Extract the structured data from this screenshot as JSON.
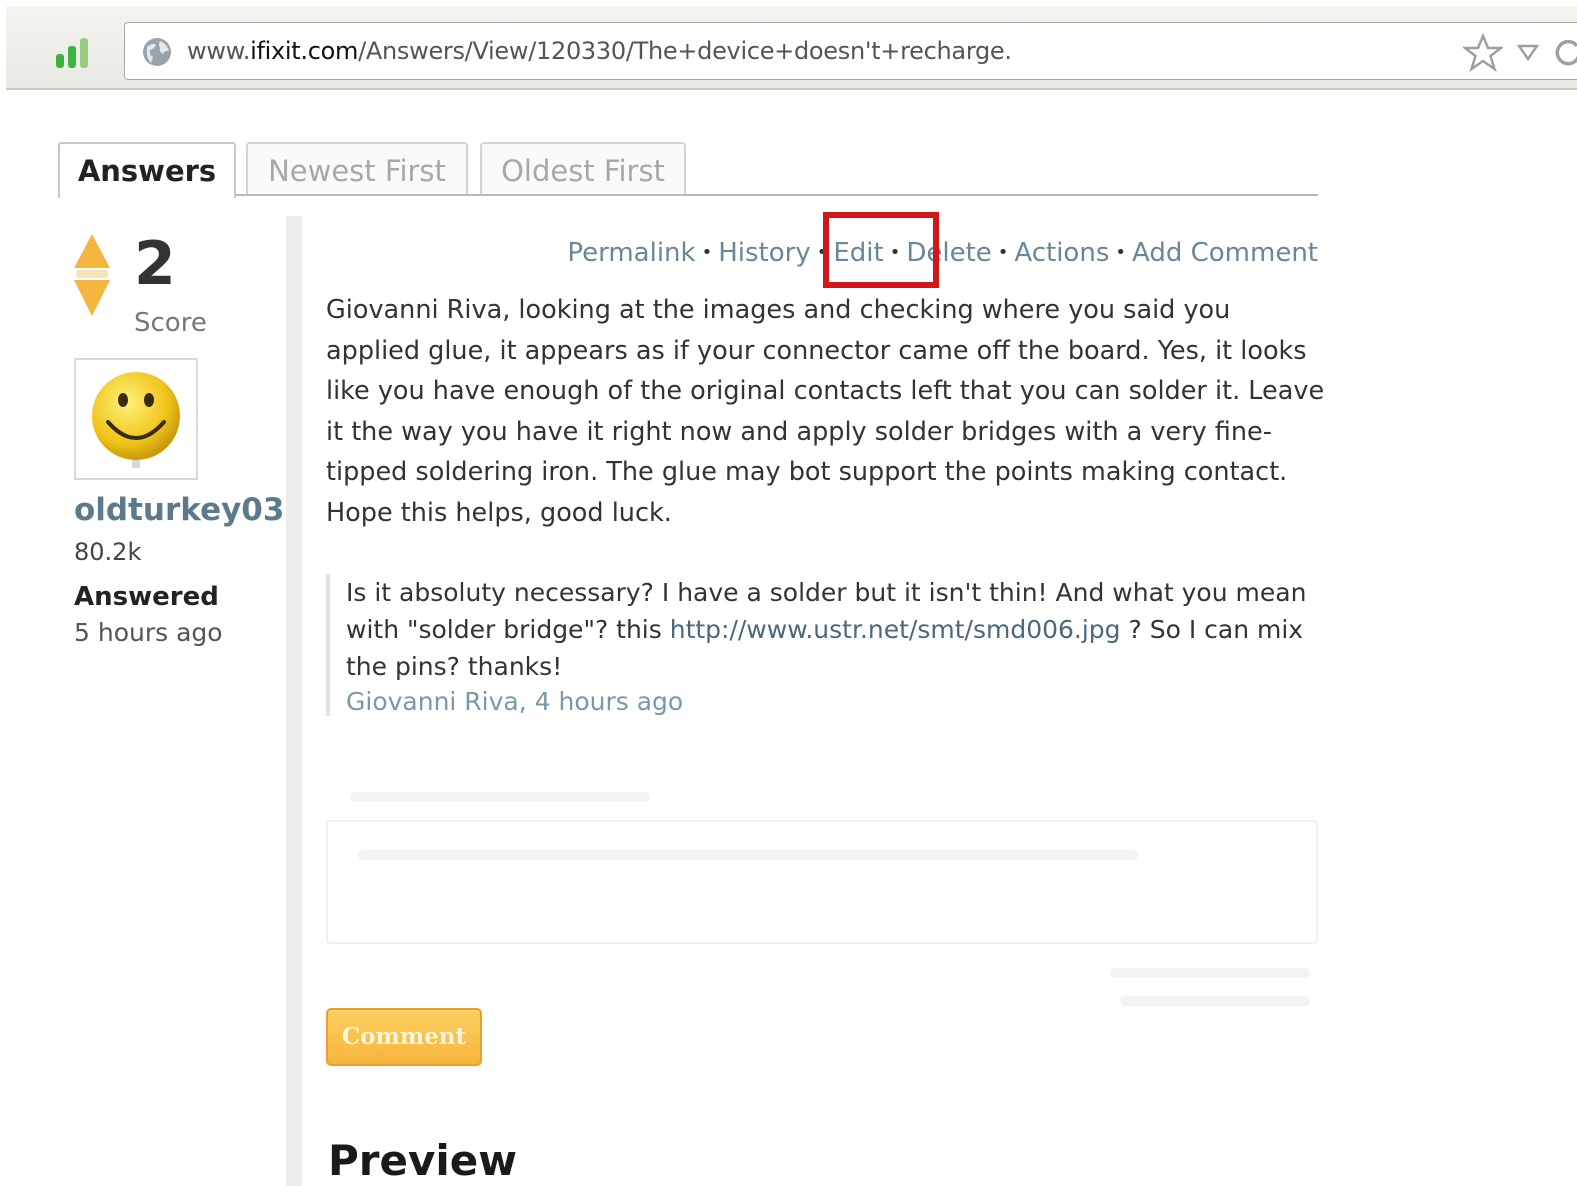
{
  "browser": {
    "url_prefix": "www.",
    "url_domain": "ifixit.com",
    "url_path": "/Answers/View/120330/The+device+doesn't+recharge."
  },
  "tabs": [
    {
      "label": "Answers",
      "active": true
    },
    {
      "label": "Newest First",
      "active": false
    },
    {
      "label": "Oldest First",
      "active": false
    }
  ],
  "answer": {
    "score": "2",
    "score_label": "Score",
    "author": "oldturkey03",
    "reputation": "80.2k",
    "answered_label": "Answered",
    "answered_time": "5 hours ago",
    "actions": [
      "Permalink",
      "History",
      "Edit",
      "Delete",
      "Actions",
      "Add Comment"
    ],
    "body": "Giovanni Riva, looking at the images and checking where you said you applied glue, it appears as if your connector came off the board. Yes, it looks like you have enough of the original contacts left that you can solder it. Leave it the way you have it right now and apply solder bridges with a very fine-tipped soldering iron. The glue may bot support the points making contact. Hope this helps, good luck."
  },
  "comment": {
    "text_before": "Is it absoluty necessary? I have a solder but it isn't thin! And what you mean with \"solder bridge\"? this ",
    "link": "http://www.ustr.net/smt/smd006.jpg",
    "text_after": " ? So I can mix the pins? thanks!",
    "meta": "Giovanni Riva, 4 hours ago"
  },
  "comment_button_label": "Comment",
  "preview_heading": "Preview",
  "colors": {
    "highlight": "#d0181a",
    "vote_arrow": "#f4b63f",
    "link": "#6a8796",
    "button": "#f6b43c"
  }
}
